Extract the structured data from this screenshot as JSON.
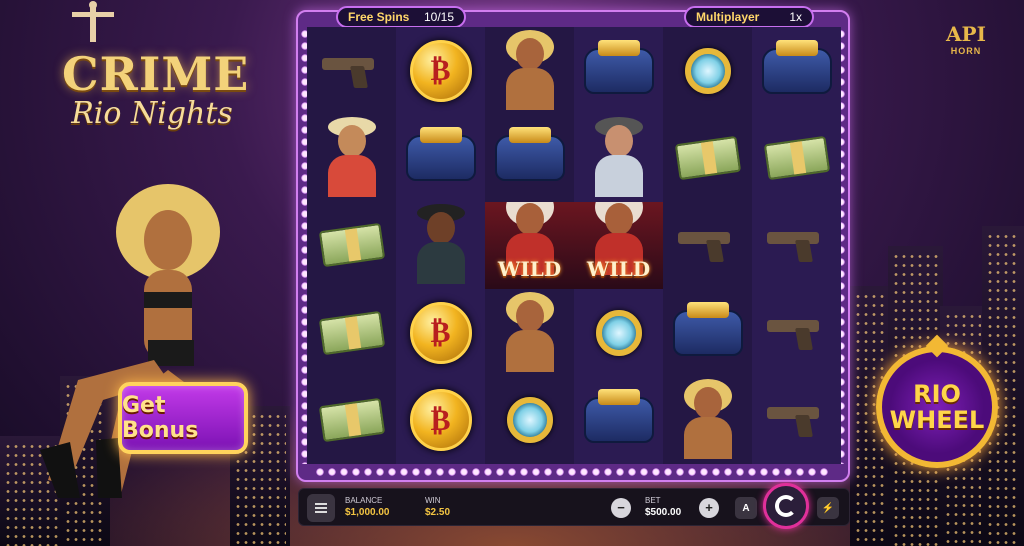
{
  "game": {
    "logo_line1": "CRIME",
    "logo_line2": "Rio Nights",
    "brand_mark": "API",
    "brand_name": "HORN"
  },
  "header": {
    "free_spins_label": "Free Spins",
    "free_spins_value": "10/15",
    "multiplayer_label": "Multiplayer",
    "multiplayer_value": "1x"
  },
  "buttons": {
    "get_bonus": "Get Bonus",
    "rio_wheel_line1": "RIO",
    "rio_wheel_line2": "WHEEL"
  },
  "wild_text": "WILD",
  "coin_glyph": "₿",
  "reels": {
    "columns": 6,
    "rows": 5,
    "symbols": [
      [
        "gun",
        "coin",
        "lady",
        "bag",
        "watch",
        "bag"
      ],
      [
        "man-blonde",
        "bag",
        "bag",
        "man-suit",
        "cash",
        "cash"
      ],
      [
        "cash",
        "man-sunglasses",
        "wild",
        "wild",
        "gun",
        "gun"
      ],
      [
        "cash",
        "coin",
        "lady",
        "watch",
        "bag",
        "gun"
      ],
      [
        "cash",
        "coin",
        "watch",
        "bag",
        "lady",
        "gun"
      ]
    ]
  },
  "bottom_bar": {
    "balance_label": "BALANCE",
    "balance_value": "$1,000.00",
    "win_label": "WIN",
    "win_value": "$2.50",
    "bet_label": "BET",
    "bet_value": "$500.00",
    "minus": "−",
    "plus": "+",
    "auto": "A",
    "turbo": "⚡"
  },
  "colors": {
    "accent_gold": "#ffd45c",
    "frame_purple": "#5e2a86",
    "spin_ring": "#e0309a"
  }
}
